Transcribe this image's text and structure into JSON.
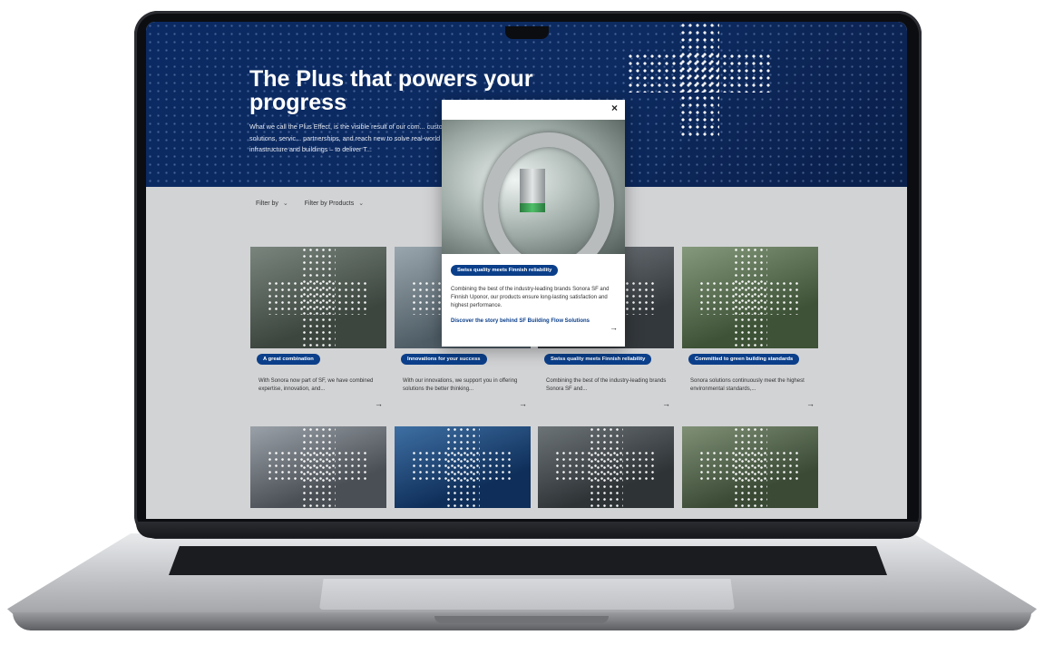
{
  "hero": {
    "title": "The Plus that powers your progress",
    "text": "What we call the Plus Effect, is the visible result of our com... customers with a strong portfolio, proven solutions, servic... partnerships, and reach new to solve real-world challenges... areas – industry, infrastructure and buildings – to deliver T..."
  },
  "filters": [
    {
      "label": "Filter by"
    },
    {
      "label": "Filter by Products"
    }
  ],
  "cards": [
    {
      "tag": "A great combination",
      "text": "With Sonora now part of SF, we have combined expertise, innovation, and...",
      "img": [
        "#3c463f",
        "#7a857e"
      ]
    },
    {
      "tag": "Innovations for your success",
      "text": "With our innovations, we support you in offering solutions the better thinking...",
      "img": [
        "#4f5d66",
        "#9aa6ad"
      ]
    },
    {
      "tag": "Swiss quality meets Finnish reliability",
      "text": "Combining the best of the industry-leading brands Sonora SF and...",
      "img": [
        "#33383c",
        "#747b80"
      ]
    },
    {
      "tag": "Committed to green building standards",
      "text": "Sonora solutions continuously meet the highest environmental standards,...",
      "img": [
        "#3d5236",
        "#85997c"
      ]
    }
  ],
  "cards_row2": [
    {
      "img": [
        "#4a4f55",
        "#9aa1a8"
      ]
    },
    {
      "img": [
        "#0f2f5a",
        "#3e6fa3"
      ]
    },
    {
      "img": [
        "#2e3336",
        "#6c7377"
      ]
    },
    {
      "img": [
        "#3a4a35",
        "#7f9076"
      ]
    }
  ],
  "modal": {
    "close": "×",
    "tag": "Swiss quality meets Finnish reliability",
    "text": "Combining the best of the industry-leading brands Sonora SF and Finnish Uponor, our products ensure long-lasting satisfaction and highest performance.",
    "link": "Discover the story behind SF Building Flow Solutions"
  },
  "icons": {
    "arrow": "→",
    "chevron": "⌄"
  },
  "colors": {
    "brand_blue": "#0b3f8a",
    "hero_bg": "#0d2b61"
  }
}
